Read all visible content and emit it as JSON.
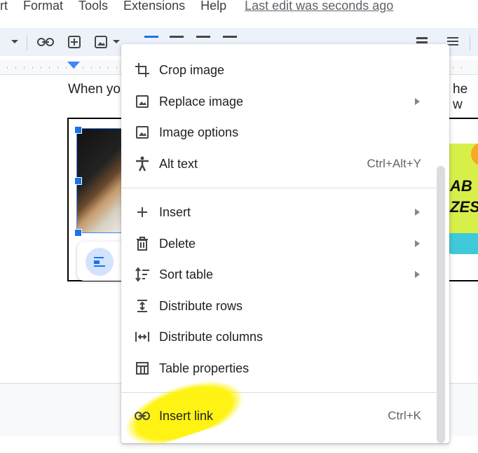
{
  "menubar": {
    "items": [
      "rt",
      "Format",
      "Tools",
      "Extensions",
      "Help"
    ],
    "last_edit": "Last edit was seconds ago"
  },
  "toolbar": {
    "icons": [
      "chevron-down-icon",
      "link-icon",
      "add-comment-icon",
      "image-icon",
      "align-left-icon",
      "align-center-icon",
      "align-right-icon",
      "justify-icon",
      "line-spacing-icon",
      "checklist-icon",
      "bulleted-list-icon",
      "numbered-list-icon",
      "decrease-indent-icon",
      "increase-indent-icon"
    ]
  },
  "document": {
    "text_left": "When yo",
    "text_right": "he w",
    "sticker_line1": "AB",
    "sticker_line2": "ZES"
  },
  "context_menu": {
    "items": [
      {
        "label": "Crop image",
        "icon": "crop-icon",
        "shortcut": "",
        "submenu": false
      },
      {
        "label": "Replace image",
        "icon": "image-icon",
        "shortcut": "",
        "submenu": true
      },
      {
        "label": "Image options",
        "icon": "image-options-icon",
        "shortcut": "",
        "submenu": false
      },
      {
        "label": "Alt text",
        "icon": "accessibility-icon",
        "shortcut": "Ctrl+Alt+Y",
        "submenu": false
      },
      {
        "label": "Insert",
        "icon": "plus-icon",
        "shortcut": "",
        "submenu": true
      },
      {
        "label": "Delete",
        "icon": "trash-icon",
        "shortcut": "",
        "submenu": true
      },
      {
        "label": "Sort table",
        "icon": "sort-icon",
        "shortcut": "",
        "submenu": true
      },
      {
        "label": "Distribute rows",
        "icon": "distribute-rows-icon",
        "shortcut": "",
        "submenu": false
      },
      {
        "label": "Distribute columns",
        "icon": "distribute-columns-icon",
        "shortcut": "",
        "submenu": false
      },
      {
        "label": "Table properties",
        "icon": "table-icon",
        "shortcut": "",
        "submenu": false
      },
      {
        "label": "Insert link",
        "icon": "link-icon",
        "shortcut": "Ctrl+K",
        "submenu": false
      }
    ]
  },
  "colors": {
    "accent": "#1a73e8",
    "highlight": "#fff200",
    "sticker": "#d8ef4a"
  }
}
